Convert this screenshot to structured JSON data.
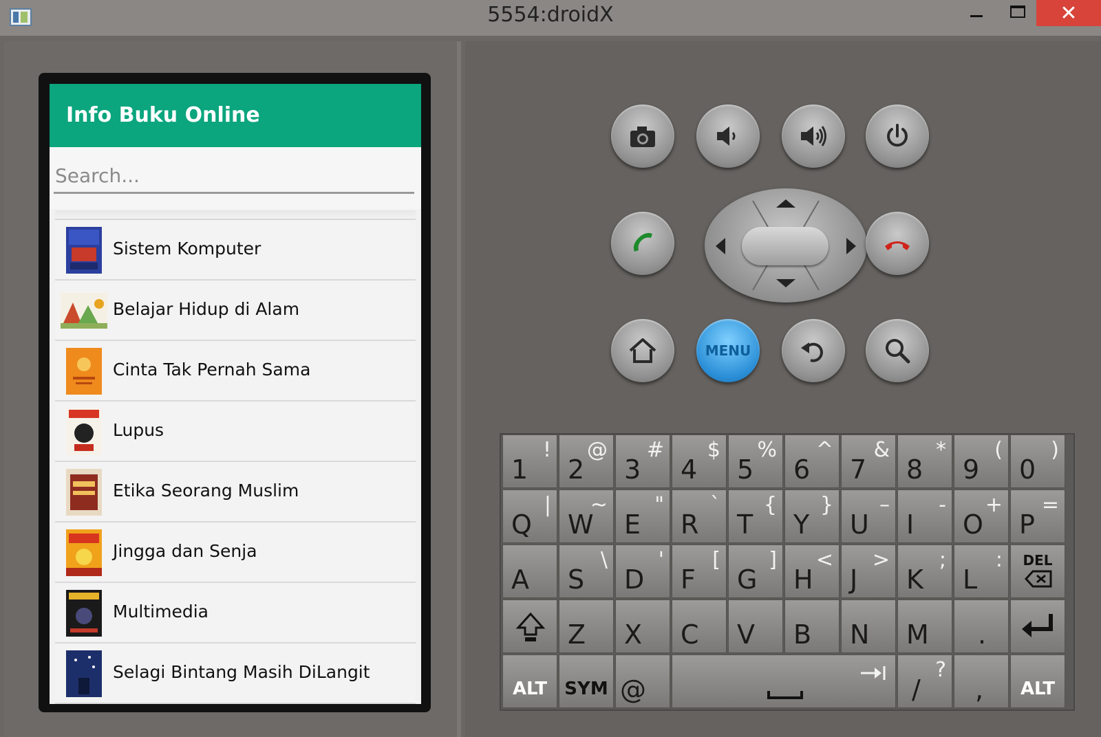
{
  "window": {
    "title": "5554:droidX",
    "close_glyph": "✕"
  },
  "app": {
    "title": "Info Buku Online",
    "search_placeholder": "Search...",
    "books": [
      {
        "title": "Sistem Komputer",
        "cover": "blue"
      },
      {
        "title": "Belajar Hidup di Alam",
        "cover": "illustration"
      },
      {
        "title": "Cinta Tak Pernah Sama",
        "cover": "orange"
      },
      {
        "title": "Lupus",
        "cover": "red-white"
      },
      {
        "title": "Etika Seorang Muslim",
        "cover": "brown-red"
      },
      {
        "title": "Jingga dan Senja",
        "cover": "yellow-red"
      },
      {
        "title": "Multimedia",
        "cover": "dark"
      },
      {
        "title": "Selagi Bintang Masih DiLangit",
        "cover": "night-blue"
      }
    ]
  },
  "controls": {
    "menu_label": "MENU",
    "accent": "#0ba57e",
    "menu_color": "#2a8ed6"
  },
  "keyboard": {
    "row1": [
      {
        "main": "1",
        "alt": "!"
      },
      {
        "main": "2",
        "alt": "@"
      },
      {
        "main": "3",
        "alt": "#"
      },
      {
        "main": "4",
        "alt": "$"
      },
      {
        "main": "5",
        "alt": "%"
      },
      {
        "main": "6",
        "alt": "^"
      },
      {
        "main": "7",
        "alt": "&"
      },
      {
        "main": "8",
        "alt": "*"
      },
      {
        "main": "9",
        "alt": "("
      },
      {
        "main": "0",
        "alt": ")"
      }
    ],
    "row2": [
      {
        "main": "Q",
        "alt": "|"
      },
      {
        "main": "W",
        "alt": "~"
      },
      {
        "main": "E",
        "alt": "\""
      },
      {
        "main": "R",
        "alt": "`"
      },
      {
        "main": "T",
        "alt": "{"
      },
      {
        "main": "Y",
        "alt": "}"
      },
      {
        "main": "U",
        "alt": "–"
      },
      {
        "main": "I",
        "alt": "-"
      },
      {
        "main": "O",
        "alt": "+"
      },
      {
        "main": "P",
        "alt": "="
      }
    ],
    "row3": [
      {
        "main": "A",
        "alt": ""
      },
      {
        "main": "S",
        "alt": "\\"
      },
      {
        "main": "D",
        "alt": "'"
      },
      {
        "main": "F",
        "alt": "["
      },
      {
        "main": "G",
        "alt": "]"
      },
      {
        "main": "H",
        "alt": "<"
      },
      {
        "main": "J",
        "alt": ">"
      },
      {
        "main": "K",
        "alt": ";"
      },
      {
        "main": "L",
        "alt": ":"
      }
    ],
    "del_label": "DEL",
    "row4": [
      {
        "main": "Z",
        "alt": ""
      },
      {
        "main": "X",
        "alt": ""
      },
      {
        "main": "C",
        "alt": ""
      },
      {
        "main": "V",
        "alt": ""
      },
      {
        "main": "B",
        "alt": ""
      },
      {
        "main": "N",
        "alt": ""
      },
      {
        "main": "M",
        "alt": ""
      },
      {
        "main": ".",
        "alt": ""
      }
    ],
    "alt_label": "ALT",
    "sym_label": "SYM",
    "at_label": "@",
    "slash_key": {
      "main": "/",
      "alt": "?"
    },
    "comma_key": {
      "main": ",",
      "alt": ""
    }
  }
}
